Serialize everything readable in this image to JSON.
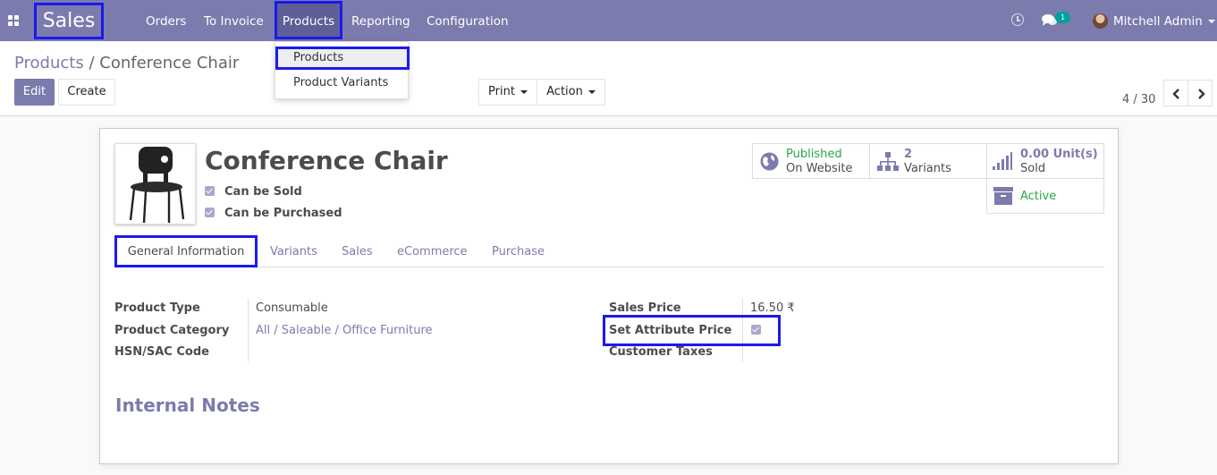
{
  "topbar": {
    "brand": "Sales",
    "menu": [
      {
        "label": "Orders"
      },
      {
        "label": "To Invoice"
      },
      {
        "label": "Products"
      },
      {
        "label": "Reporting"
      },
      {
        "label": "Configuration"
      }
    ],
    "messages_badge": "1",
    "user_name": "Mitchell Admin"
  },
  "products_dropdown": {
    "items": [
      {
        "label": "Products"
      },
      {
        "label": "Product Variants"
      }
    ]
  },
  "control_panel": {
    "breadcrumb_parent": "Products",
    "breadcrumb_separator": "/",
    "breadcrumb_current": "Conference Chair",
    "edit_label": "Edit",
    "create_label": "Create",
    "print_label": "Print",
    "action_label": "Action",
    "pager": "4 / 30"
  },
  "product": {
    "name": "Conference Chair",
    "can_be_sold_label": "Can be Sold",
    "can_be_purchased_label": "Can be Purchased",
    "can_be_sold": true,
    "can_be_purchased": true
  },
  "smart_buttons": {
    "published": {
      "line1": "Published",
      "line2": "On Website"
    },
    "variants": {
      "count": "2",
      "label": "Variants"
    },
    "sold": {
      "value": "0.00",
      "unit": "Unit(s)",
      "label": "Sold"
    },
    "active": {
      "label": "Active"
    }
  },
  "tabs": [
    {
      "label": "General Information"
    },
    {
      "label": "Variants"
    },
    {
      "label": "Sales"
    },
    {
      "label": "eCommerce"
    },
    {
      "label": "Purchase"
    }
  ],
  "general_info": {
    "left": [
      {
        "label": "Product Type",
        "value": "Consumable"
      },
      {
        "label": "Product Category",
        "value": "All / Saleable / Office Furniture"
      },
      {
        "label": "HSN/SAC Code",
        "value": ""
      }
    ],
    "right": [
      {
        "label": "Sales Price",
        "value": "16.50 ₹"
      },
      {
        "label": "Set Attribute Price",
        "value": ""
      },
      {
        "label": "Customer Taxes",
        "value": ""
      }
    ],
    "set_attribute_price_checked": true
  },
  "internal_notes_title": "Internal Notes",
  "colors": {
    "brand": "#7c7bad",
    "highlight": "#1a1aee",
    "success": "#28a745"
  },
  "icons": {
    "apps": "grid-icon",
    "activity": "clock-icon",
    "messages": "chat-icon",
    "published": "globe-icon",
    "variants": "sitemap-icon",
    "sold": "signal-icon",
    "active": "archive-icon",
    "prev": "chevron-left-icon",
    "next": "chevron-right-icon"
  }
}
